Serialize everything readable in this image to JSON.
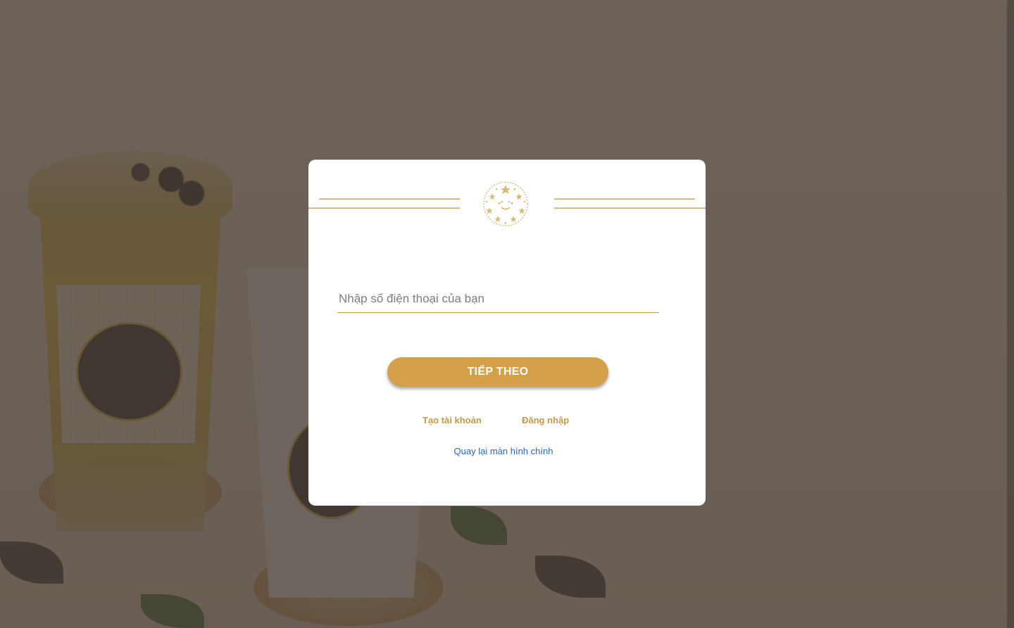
{
  "login": {
    "phone_placeholder": "Nhập số điện thoại của bạn",
    "next_button": "TIẾP THEO",
    "create_account": "Tạo tài khoản",
    "sign_in": "Đăng nhập",
    "back_to_main": "Quay lại màn hình chính"
  },
  "colors": {
    "accent_gold": "#d4a14a",
    "link_gold": "#c39a47",
    "link_blue": "#2a66c8",
    "overlay": "#5f5850"
  },
  "icons": {
    "logo": "star-face-logo"
  }
}
